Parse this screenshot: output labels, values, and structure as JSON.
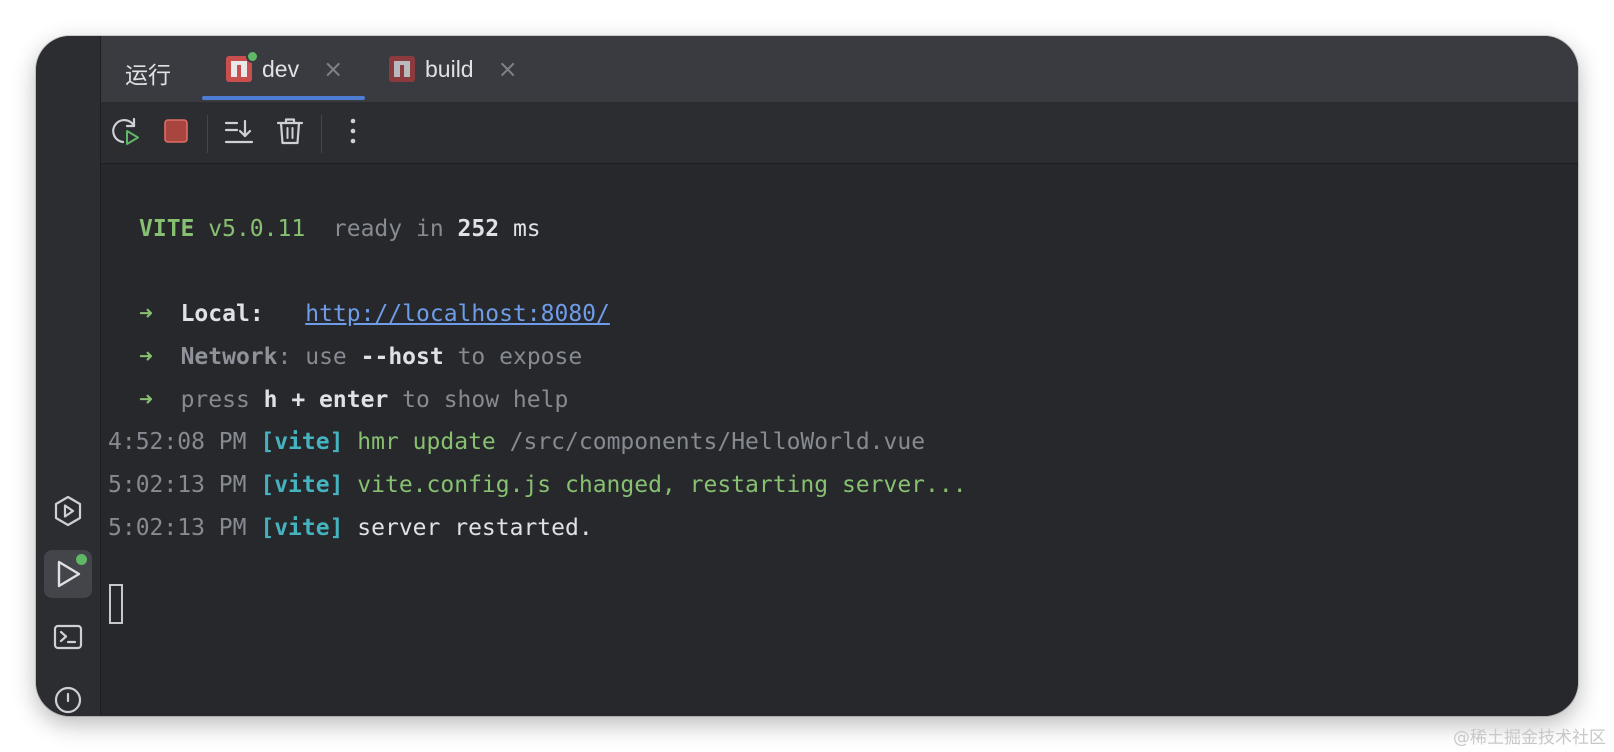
{
  "panel": {
    "title": "运行",
    "tabs": [
      {
        "label": "dev",
        "close": "×",
        "active": true,
        "running": true
      },
      {
        "label": "build",
        "close": "×",
        "active": false,
        "running": false
      }
    ]
  },
  "toolbar": {
    "icons": [
      "rerun-icon",
      "stop-icon",
      "scroll-to-end-icon",
      "clear-icon",
      "more-vertical-icon"
    ]
  },
  "sidebar": {
    "icons": [
      "services-icon",
      "run-icon",
      "terminal-icon",
      "problems-icon"
    ]
  },
  "console": {
    "banner": {
      "name": "VITE",
      "version": "v5.0.11",
      "ready_text": "ready in",
      "ready_value": "252",
      "ready_unit": "ms"
    },
    "local": {
      "arrow": "➜",
      "label": "Local",
      "colon": ":",
      "url": "http://localhost:8080/"
    },
    "network": {
      "arrow": "➜",
      "label": "Network",
      "colon": ":",
      "use": "use",
      "flag": "--host",
      "rest": "to expose"
    },
    "help": {
      "arrow": "➜",
      "press": "press",
      "key": "h + enter",
      "rest": "to show help"
    },
    "logs": [
      {
        "time": "4:52:08 PM",
        "tag": "[vite]",
        "msg": "hmr update",
        "detail": "/src/components/HelloWorld.vue"
      },
      {
        "time": "5:02:13 PM",
        "tag": "[vite]",
        "msg": "vite.config.js changed, restarting server...",
        "detail": ""
      },
      {
        "time": "5:02:13 PM",
        "tag": "[vite]",
        "msg": "server restarted.",
        "detail": ""
      }
    ]
  },
  "watermark": "@稀土掘金技术社区",
  "colors": {
    "accent": "#4e7dd3",
    "running": "#5fb865",
    "stop": "#c94f4f",
    "green_text": "#88c071",
    "cyan_text": "#45b3bf",
    "link": "#6f9ce8"
  }
}
